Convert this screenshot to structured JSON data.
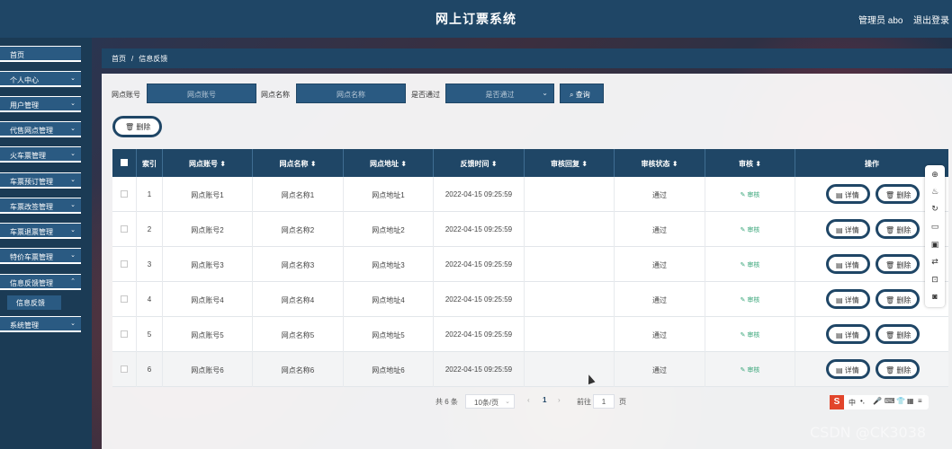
{
  "header": {
    "title": "网上订票系统",
    "user": "管理员 abo",
    "logout": "退出登录"
  },
  "sidebar": {
    "items": [
      {
        "label": "首页",
        "chevron": false
      },
      {
        "label": "个人中心",
        "chevron": true
      },
      {
        "label": "用户管理",
        "chevron": true
      },
      {
        "label": "代售网点管理",
        "chevron": true
      },
      {
        "label": "火车票管理",
        "chevron": true
      },
      {
        "label": "车票预订管理",
        "chevron": true
      },
      {
        "label": "车票改签管理",
        "chevron": true
      },
      {
        "label": "车票退票管理",
        "chevron": true
      },
      {
        "label": "特价车票管理",
        "chevron": true
      },
      {
        "label": "信息反馈管理",
        "chevron": true
      },
      {
        "label": "系统管理",
        "chevron": true
      }
    ],
    "sub_active": "信息反馈",
    "chevron_icon": "chevron-down-icon"
  },
  "breadcrumb": {
    "home": "首页",
    "separator": "/",
    "current": "信息反馈"
  },
  "search": {
    "account_label": "网点账号",
    "account_placeholder": "网点账号",
    "name_label": "网点名称",
    "name_placeholder": "网点名称",
    "passed_label": "是否通过",
    "passed_select": "是否通过",
    "query_button": "查询",
    "delete_button": "删除"
  },
  "table": {
    "headers": [
      "索引",
      "网点账号",
      "网点名称",
      "网点地址",
      "反馈时间",
      "审核回复",
      "审核状态",
      "审核",
      "操作"
    ],
    "sort_icon": "⬍",
    "rows": [
      {
        "index": "1",
        "account": "网点账号1",
        "name": "网点名称1",
        "address": "网点地址1",
        "time": "2022-04-15 09:25:59",
        "reply": "",
        "status": "通过",
        "audit": "审核",
        "detail": "详情",
        "delete": "删除"
      },
      {
        "index": "2",
        "account": "网点账号2",
        "name": "网点名称2",
        "address": "网点地址2",
        "time": "2022-04-15 09:25:59",
        "reply": "",
        "status": "通过",
        "audit": "审核",
        "detail": "详情",
        "delete": "删除"
      },
      {
        "index": "3",
        "account": "网点账号3",
        "name": "网点名称3",
        "address": "网点地址3",
        "time": "2022-04-15 09:25:59",
        "reply": "",
        "status": "通过",
        "audit": "审核",
        "detail": "详情",
        "delete": "删除"
      },
      {
        "index": "4",
        "account": "网点账号4",
        "name": "网点名称4",
        "address": "网点地址4",
        "time": "2022-04-15 09:25:59",
        "reply": "",
        "status": "通过",
        "audit": "审核",
        "detail": "详情",
        "delete": "删除"
      },
      {
        "index": "5",
        "account": "网点账号5",
        "name": "网点名称5",
        "address": "网点地址5",
        "time": "2022-04-15 09:25:59",
        "reply": "",
        "status": "通过",
        "audit": "审核",
        "detail": "详情",
        "delete": "删除"
      },
      {
        "index": "6",
        "account": "网点账号6",
        "name": "网点名称6",
        "address": "网点地址6",
        "time": "2022-04-15 09:25:59",
        "reply": "",
        "status": "通过",
        "audit": "审核",
        "detail": "详情",
        "delete": "删除"
      }
    ]
  },
  "pager": {
    "total": "共 6 条",
    "page_size": "10条/页",
    "current": "1",
    "goto": "前往",
    "goto_value": "1",
    "page": "页"
  },
  "ime_bar": {
    "logo": "S",
    "lang": "中"
  },
  "watermark": "CSDN @CK3038",
  "colors": {
    "primary": "#1f4666",
    "accent": "#2a5a82",
    "audit_link": "#3aa67a"
  }
}
